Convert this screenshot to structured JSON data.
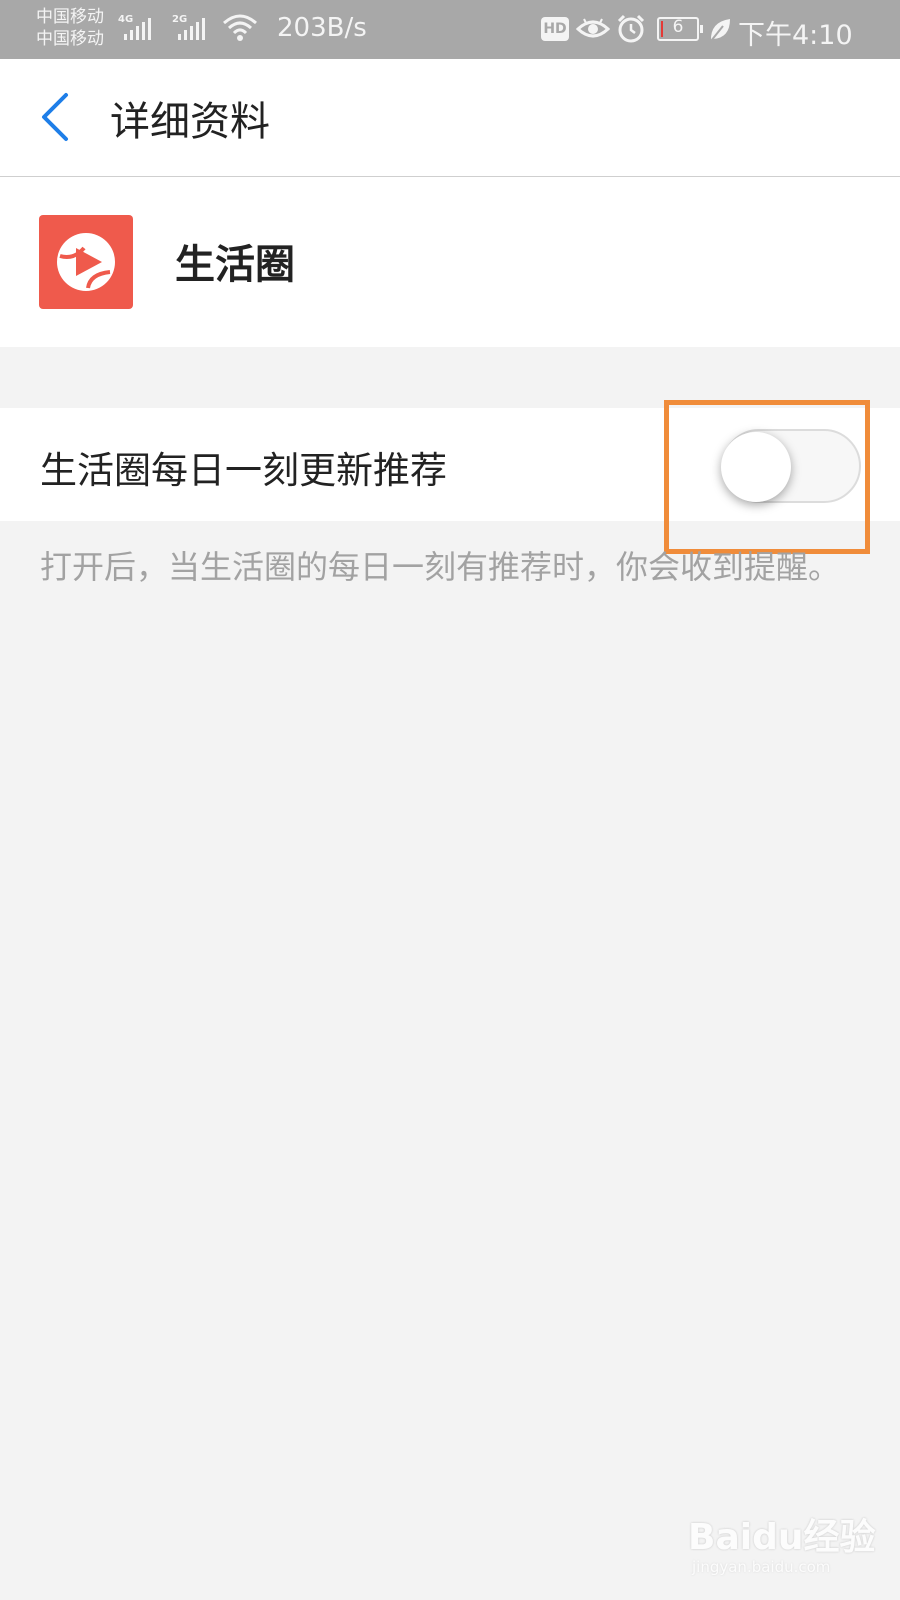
{
  "status_bar": {
    "carrier_1": "中国移动",
    "carrier_2": "中国移动",
    "signal_1_type": "4G",
    "signal_2_type": "2G",
    "net_speed": "203B/s",
    "hd_label": "HD",
    "battery_level": "6",
    "time": "下午4:10",
    "icons": [
      "signal-icon",
      "wifi-icon",
      "hd-icon",
      "eye-icon",
      "alarm-icon",
      "battery-icon",
      "leaf-icon"
    ]
  },
  "header": {
    "back_icon": "chevron-left-icon",
    "title": "详细资料"
  },
  "app": {
    "name": "生活圈",
    "logo_icon": "play-circle-logo",
    "logo_color": "#ef5a4c"
  },
  "setting": {
    "label": "生活圈每日一刻更新推荐",
    "enabled": false,
    "description": "打开后，当生活圈的每日一刻有推荐时，你会收到提醒。"
  },
  "highlight_color": "#f08c3a",
  "accent_color": "#1e7ee8",
  "watermark": {
    "brand": "Baidu经验",
    "url": "jingyan.baidu.com"
  }
}
